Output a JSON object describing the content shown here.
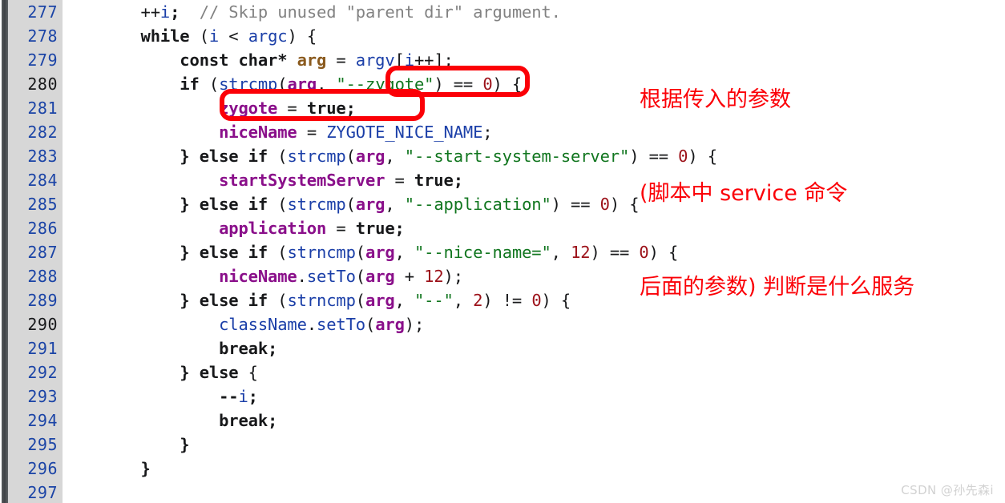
{
  "editor": {
    "language": "cpp",
    "gutter_bg": "#d7d7d7",
    "background": "#ffffff",
    "line_number_color": "#1b44a6",
    "line_number_decade_color": "#17181a",
    "first_line": 277,
    "last_line": 297
  },
  "line_numbers": [
    "277",
    "278",
    "279",
    "280",
    "281",
    "282",
    "283",
    "284",
    "285",
    "286",
    "287",
    "288",
    "289",
    "290",
    "291",
    "292",
    "293",
    "294",
    "295",
    "296",
    "297"
  ],
  "decade_lines": [
    "280",
    "290"
  ],
  "code_lines": [
    {
      "number": "277",
      "text": "        ++i;  // Skip unused \"parent dir\" argument."
    },
    {
      "number": "278",
      "text": "        while (i < argc) {"
    },
    {
      "number": "279",
      "text": "            const char* arg = argv[i++];"
    },
    {
      "number": "280",
      "text": "            if (strcmp(arg, \"--zygote\") == 0) {"
    },
    {
      "number": "281",
      "text": "                zygote = true;"
    },
    {
      "number": "282",
      "text": "                niceName = ZYGOTE_NICE_NAME;"
    },
    {
      "number": "283",
      "text": "            } else if (strcmp(arg, \"--start-system-server\") == 0) {"
    },
    {
      "number": "284",
      "text": "                startSystemServer = true;"
    },
    {
      "number": "285",
      "text": "            } else if (strcmp(arg, \"--application\") == 0) {"
    },
    {
      "number": "286",
      "text": "                application = true;"
    },
    {
      "number": "287",
      "text": "            } else if (strncmp(arg, \"--nice-name=\", 12) == 0) {"
    },
    {
      "number": "288",
      "text": "                niceName.setTo(arg + 12);"
    },
    {
      "number": "289",
      "text": "            } else if (strncmp(arg, \"--\", 2) != 0) {"
    },
    {
      "number": "290",
      "text": "                className.setTo(arg);"
    },
    {
      "number": "291",
      "text": "                break;"
    },
    {
      "number": "292",
      "text": "            } else {"
    },
    {
      "number": "293",
      "text": "                --i;"
    },
    {
      "number": "294",
      "text": "                break;"
    },
    {
      "number": "295",
      "text": "            }"
    },
    {
      "number": "296",
      "text": "        }"
    },
    {
      "number": "297",
      "text": ""
    }
  ],
  "highlights": [
    {
      "id": "zygote-string-box",
      "target": "\"--zygote\"",
      "line": "280",
      "color": "#fb0007"
    },
    {
      "id": "zygote-assign-box",
      "target": "zygote = true;",
      "line": "281",
      "color": "#fb0007"
    }
  ],
  "annotation": {
    "color": "#fb0007",
    "lines": [
      "根据传入的参数",
      "(脚本中 service 命令",
      "后面的参数) 判断是什么服务"
    ]
  },
  "watermark": {
    "text": "CSDN @孙先森i",
    "color": "#d2d2d2"
  }
}
